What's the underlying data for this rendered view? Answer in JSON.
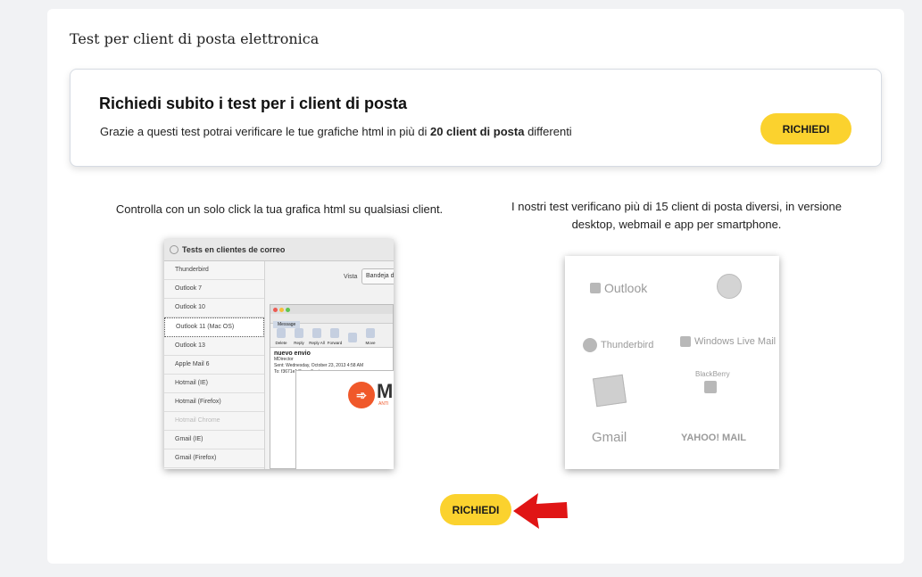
{
  "section": {
    "title": "Test per client di posta elettronica"
  },
  "cta": {
    "title": "Richiedi subito i test per i client di posta",
    "desc_before": "Grazie a questi test potrai verificare le tue grafiche html in più di ",
    "desc_bold": "20 client di posta",
    "desc_after": " differenti",
    "button_label": "RICHIEDI"
  },
  "captions": {
    "left": "Controlla con un solo click la tua grafica html su qualsiasi client.",
    "right": "I nostri test verificano più di 15 client di posta diversi, in versione desktop, webmail e app per smartphone."
  },
  "screenshot_left": {
    "header": "Tests en clientes de correo",
    "clients": [
      "Thunderbird",
      "Outlook 7",
      "Outlook 10",
      "Outlook 11 (Mac OS)",
      "Outlook 13",
      "Apple Mail 6",
      "Hotmail (IE)",
      "Hotmail (Firefox)",
      "Hotmail Chrome",
      "Gmail (IE)",
      "Gmail (Firefox)"
    ],
    "vista_label": "Vista",
    "vista_value": "Bandeja d",
    "tab": "Message",
    "tools": [
      "Delete",
      "Reply",
      "Reply All",
      "Forward",
      "",
      "Move"
    ],
    "subject": "nuevo envio",
    "sender": "MDirector",
    "sent": "Sent: Wednesday, October 23, 2013 4:58 AM",
    "to": "To: f3671e1@emailtests.com",
    "publicidad": "Publicidad",
    "logo_letter": "M",
    "logo_sub": "ANTI"
  },
  "screenshot_right": {
    "clients": [
      "Outlook",
      "Thunderbird",
      "Windows Live Mail",
      "BlackBerry",
      "Gmail",
      "YAHOO! MAIL"
    ]
  },
  "bottom": {
    "button_label": "RICHIEDI"
  },
  "colors": {
    "button": "#fbd22e",
    "arrow": "#e01515"
  }
}
